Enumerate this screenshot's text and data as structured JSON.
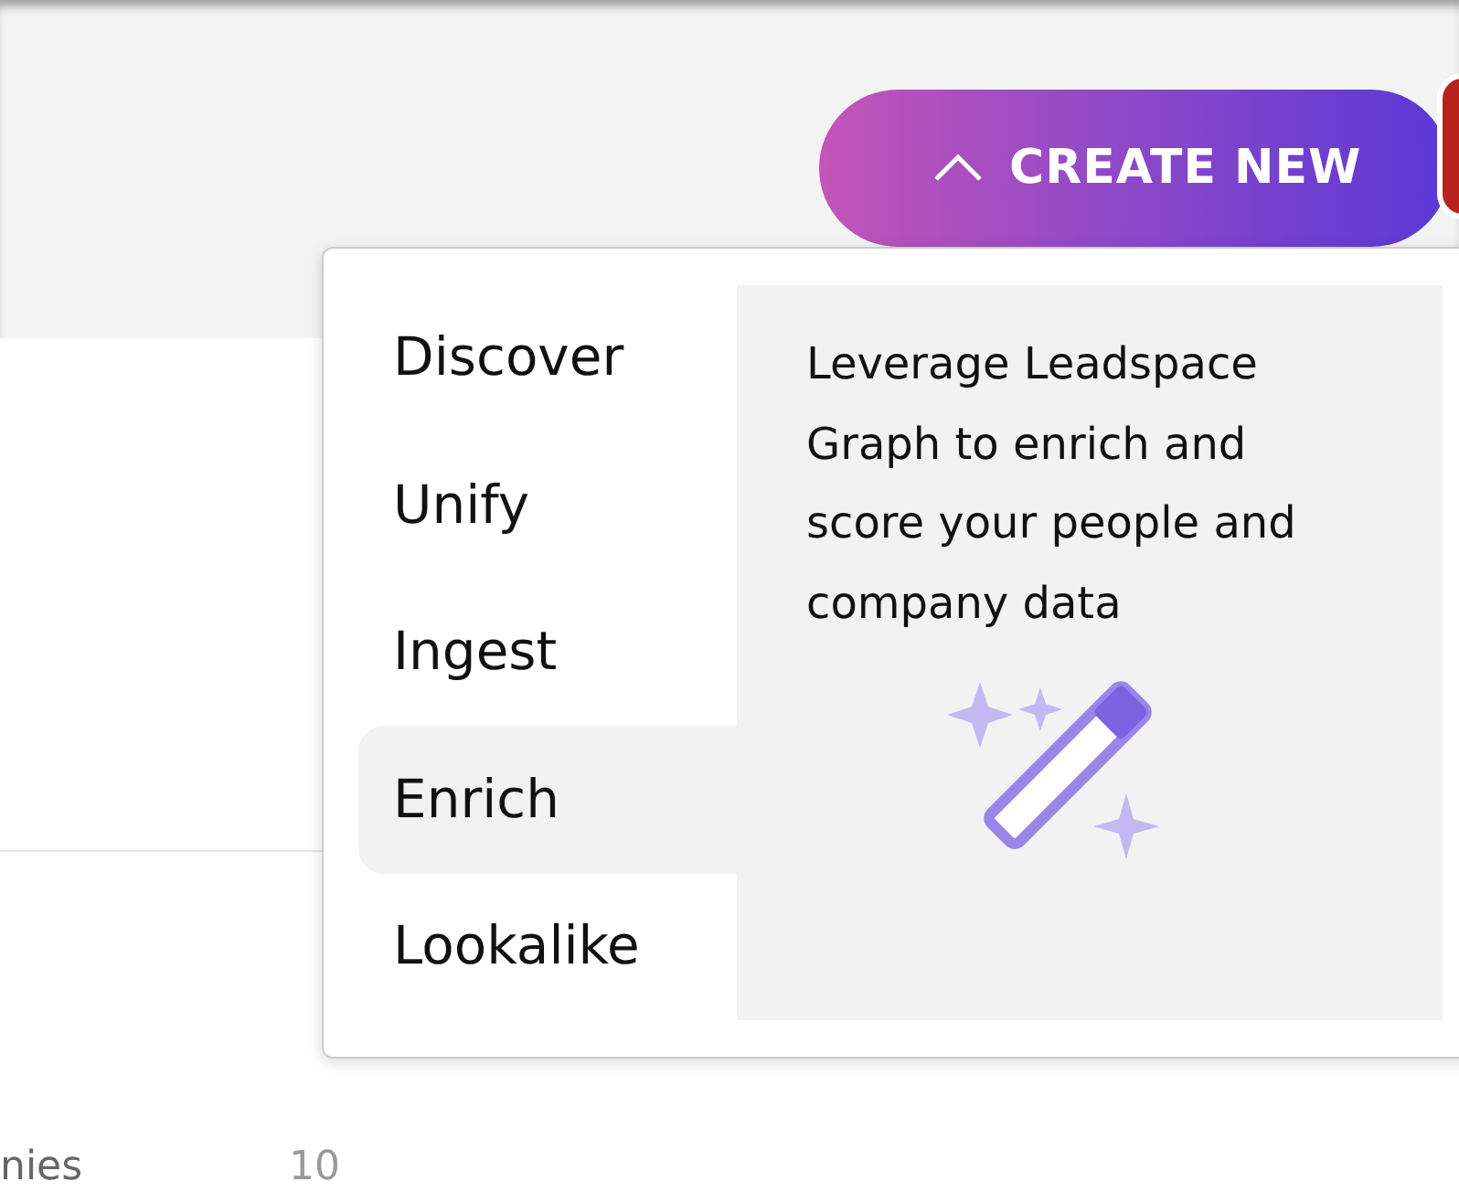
{
  "header": {
    "create_button": {
      "label": "CREATE NEW",
      "expanded": true
    }
  },
  "menu": {
    "items": [
      {
        "label": "Discover",
        "selected": false
      },
      {
        "label": "Unify",
        "selected": false
      },
      {
        "label": "Ingest",
        "selected": false
      },
      {
        "label": "Enrich",
        "selected": true
      },
      {
        "label": "Lookalike",
        "selected": false
      }
    ],
    "description": "Leverage Leadspace Graph to enrich and score your people and company data"
  },
  "list_row": {
    "label": "nies",
    "value": "10"
  }
}
